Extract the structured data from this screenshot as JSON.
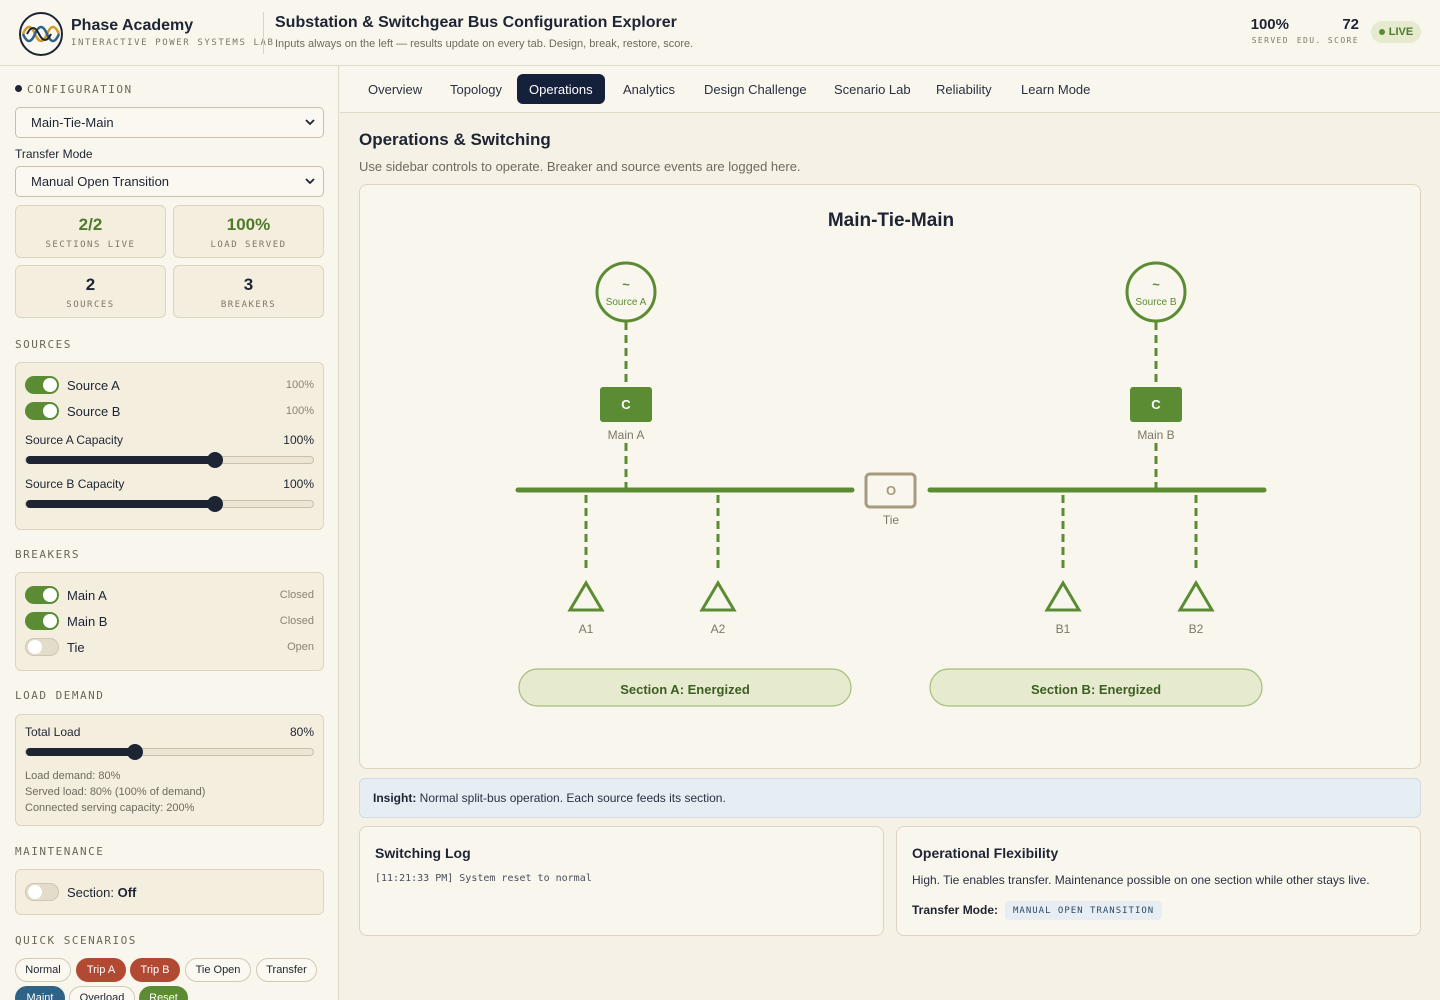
{
  "brand": {
    "name": "Phase Academy",
    "tagline": "INTERACTIVE POWER SYSTEMS LAB"
  },
  "app": {
    "title": "Substation & Switchgear Bus Configuration Explorer",
    "subtitle": "Inputs always on the left — results update on every tab. Design, break, restore, score."
  },
  "header_metrics": {
    "served": {
      "value": "100%",
      "label": "SERVED"
    },
    "score": {
      "value": "72",
      "label": "EDU. SCORE"
    },
    "live": "LIVE"
  },
  "sidebar": {
    "configuration_label": "CONFIGURATION",
    "configuration_value": "Main-Tie-Main",
    "transfer_mode_label": "Transfer Mode",
    "transfer_mode_value": "Manual Open Transition",
    "stats": [
      {
        "value": "2/2",
        "label": "SECTIONS LIVE",
        "color": "#4f7a2b"
      },
      {
        "value": "100%",
        "label": "LOAD SERVED",
        "color": "#4f7a2b"
      },
      {
        "value": "2",
        "label": "SOURCES",
        "color": "#1d2433"
      },
      {
        "value": "3",
        "label": "BREAKERS",
        "color": "#1d2433"
      }
    ],
    "sources_label": "SOURCES",
    "sources": [
      {
        "name": "Source A",
        "value": "100%",
        "on": true
      },
      {
        "name": "Source B",
        "value": "100%",
        "on": true
      }
    ],
    "capacity": [
      {
        "label": "Source A Capacity",
        "value": "100%",
        "level": 0.66
      },
      {
        "label": "Source B Capacity",
        "value": "100%",
        "level": 0.66
      }
    ],
    "breakers_label": "BREAKERS",
    "breakers": [
      {
        "name": "Main A",
        "state": "Closed",
        "on": true
      },
      {
        "name": "Main B",
        "state": "Closed",
        "on": true
      },
      {
        "name": "Tie",
        "state": "Open",
        "on": false
      }
    ],
    "load_label": "LOAD DEMAND",
    "total_load_label": "Total Load",
    "total_load_value": "80%",
    "total_load_level": 0.38,
    "load_info": [
      "Load demand: 80%",
      "Served load: 80% (100% of demand)",
      "Connected serving capacity: 200%"
    ],
    "maintenance_label": "MAINTENANCE",
    "maintenance_prefix": "Section:",
    "maintenance_state": "Off",
    "quick_label": "QUICK SCENARIOS",
    "quick": [
      "Normal",
      "Trip A",
      "Trip B",
      "Tie Open",
      "Transfer",
      "Maint",
      "Overload",
      "Reset"
    ]
  },
  "tabs": [
    "Overview",
    "Topology",
    "Operations",
    "Analytics",
    "Design Challenge",
    "Scenario Lab",
    "Reliability",
    "Learn Mode"
  ],
  "active_tab": "Operations",
  "main": {
    "title": "Operations & Switching",
    "subtitle": "Use sidebar controls to operate. Breaker and source events are logged here."
  },
  "diagram": {
    "title": "Main-Tie-Main",
    "source_symbol": "~",
    "sources": [
      "Source A",
      "Source B"
    ],
    "breakers": [
      {
        "name": "Main A",
        "symbol": "C"
      },
      {
        "name": "Main B",
        "symbol": "C"
      },
      {
        "name": "Tie",
        "symbol": "O"
      }
    ],
    "loads": [
      "A1",
      "A2",
      "B1",
      "B2"
    ],
    "sections": [
      "Section A: Energized",
      "Section B: Energized"
    ],
    "colors": {
      "energized": "#5b8c33",
      "open": "#a89a7d",
      "section_fill": "#e6ebcf"
    }
  },
  "insight": {
    "label": "Insight:",
    "text": "Normal split-bus operation. Each source feeds its section."
  },
  "switching_log": {
    "title": "Switching Log",
    "entries": [
      "[11:21:33 PM] System reset to normal"
    ]
  },
  "flexibility": {
    "title": "Operational Flexibility",
    "text": "High. Tie enables transfer. Maintenance possible on one section while other stays live.",
    "transfer_label": "Transfer Mode:",
    "transfer_value": "MANUAL OPEN TRANSITION"
  }
}
